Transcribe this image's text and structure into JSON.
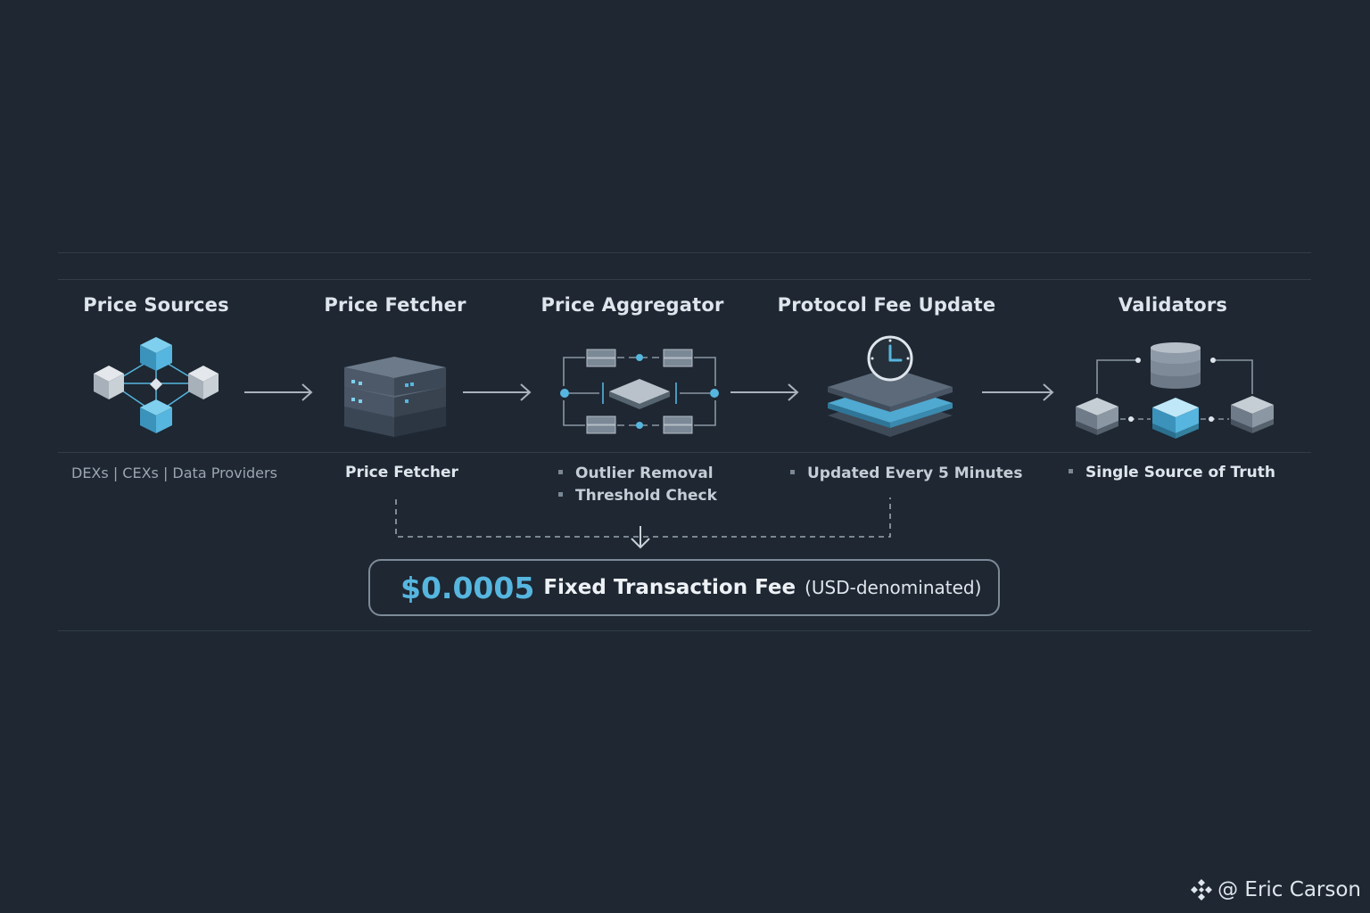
{
  "stages": [
    {
      "title": "Price Sources",
      "icon": "cube-network-icon",
      "caption": "DEXs | CEXs | Data Providers"
    },
    {
      "title": "Price Fetcher",
      "icon": "server-stack-icon",
      "caption": "Price Fetcher"
    },
    {
      "title": "Price Aggregator",
      "icon": "aggregator-network-icon",
      "bullets": [
        "Outlier Removal",
        "Threshold Check"
      ]
    },
    {
      "title": "Protocol Fee Update",
      "icon": "clock-layers-icon",
      "bullets": [
        "Updated Every 5 Minutes"
      ]
    },
    {
      "title": "Validators",
      "icon": "database-validators-icon",
      "bullets": [
        "Single Source of Truth"
      ]
    }
  ],
  "fee": {
    "amount": "$0.0005",
    "label": "Fixed Transaction Fee",
    "note": "(USD-denominated)"
  },
  "watermark": {
    "text": "@ Eric Carson",
    "icon": "binance-logo-icon"
  },
  "colors": {
    "background": "#1e2732",
    "accent": "#56b6df",
    "gray": "#8a96a3",
    "dark": "#4a5765"
  }
}
